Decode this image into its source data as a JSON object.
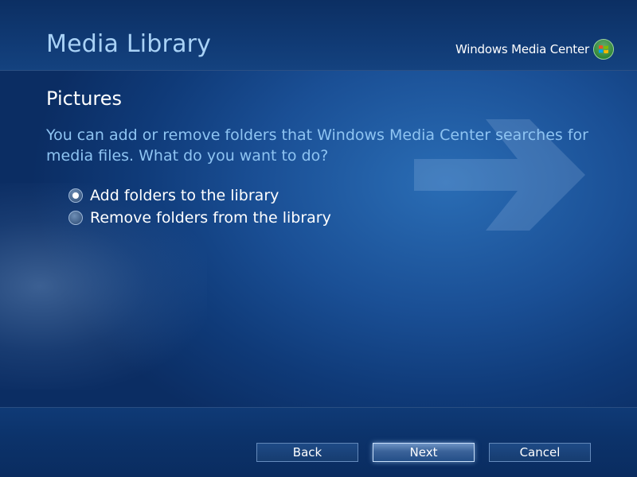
{
  "header": {
    "title": "Media Library",
    "brand": "Windows Media Center"
  },
  "main": {
    "section_title": "Pictures",
    "prompt": "You can add or remove folders that Windows Media Center searches for media files. What do you want to do?",
    "options": [
      {
        "label": "Add folders to the library",
        "selected": true
      },
      {
        "label": "Remove folders from the library",
        "selected": false
      }
    ]
  },
  "footer": {
    "back_label": "Back",
    "next_label": "Next",
    "cancel_label": "Cancel"
  },
  "colors": {
    "title": "#a9d2f6",
    "prompt": "#8ec4f2",
    "background": "#1a4f95"
  }
}
